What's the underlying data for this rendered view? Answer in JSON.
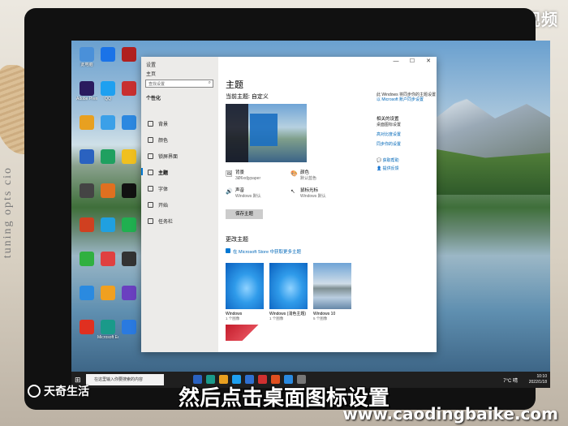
{
  "watermark_top": "天奇·视频",
  "book_text": "tuning opts cio",
  "desktop_icons": [
    {
      "label": "此电脑",
      "color": "#4a90d9"
    },
    {
      "label": "",
      "color": "#1a73e8"
    },
    {
      "label": "",
      "color": "#b02020"
    },
    {
      "label": "Adobe Premi...",
      "color": "#2a1a5e"
    },
    {
      "label": "QQ",
      "color": "#1ea0f0"
    },
    {
      "label": "",
      "color": "#c83030"
    },
    {
      "label": "",
      "color": "#e8a020"
    },
    {
      "label": "",
      "color": "#3ba0e8"
    },
    {
      "label": "",
      "color": "#2c88e0"
    },
    {
      "label": "",
      "color": "#2a62c0"
    },
    {
      "label": "",
      "color": "#20a060"
    },
    {
      "label": "",
      "color": "#f0c020"
    },
    {
      "label": "",
      "color": "#444"
    },
    {
      "label": "",
      "color": "#e07020"
    },
    {
      "label": "",
      "color": "#111"
    },
    {
      "label": "",
      "color": "#d04020"
    },
    {
      "label": "",
      "color": "#20a0e0"
    },
    {
      "label": "",
      "color": "#20b050"
    },
    {
      "label": "",
      "color": "#30b040"
    },
    {
      "label": "",
      "color": "#e04040"
    },
    {
      "label": "",
      "color": "#333"
    },
    {
      "label": "",
      "color": "#2a8ae0"
    },
    {
      "label": "",
      "color": "#f0a020"
    },
    {
      "label": "",
      "color": "#6a40c0"
    },
    {
      "label": "",
      "color": "#e03020"
    },
    {
      "label": "Microsoft Edge",
      "color": "#1a9a8a"
    },
    {
      "label": "",
      "color": "#2a7ae0"
    }
  ],
  "window": {
    "title": "设置",
    "home": "主页",
    "search_placeholder": "查找设置",
    "section": "个性化",
    "nav_items": [
      "背景",
      "颜色",
      "锁屏界面",
      "主题",
      "字体",
      "开始",
      "任务栏"
    ],
    "page_title": "主题",
    "current_theme": "当前主题: 自定义",
    "props": [
      {
        "icon": "🖼",
        "title": "背景",
        "sub": "3Ø6xdjypaper"
      },
      {
        "icon": "🎨",
        "title": "颜色",
        "sub": "默认蓝色"
      },
      {
        "icon": "🔊",
        "title": "声音",
        "sub": "Windows 默认"
      },
      {
        "icon": "↖",
        "title": "鼠标光标",
        "sub": "Windows 默认"
      }
    ],
    "save_theme": "保存主题",
    "change_theme": "更改主题",
    "store_link": "在 Microsoft Store 中获取更多主题",
    "themes": [
      {
        "name": "Windows",
        "sub": "1 个图像"
      },
      {
        "name": "Windows (浅色主题)",
        "sub": "1 个图像"
      },
      {
        "name": "Windows 10",
        "sub": "5 个图像"
      }
    ],
    "right": {
      "sync_text": "此 Windows 将同步你的主题设置",
      "sync_link": "以 Microsoft 账户同步设置",
      "related_head": "相关的设置",
      "desktop_icons_link": "桌面图标设置",
      "contrast_link": "高对比度设置",
      "sync_settings_link": "同步你的设置",
      "help": "获取帮助",
      "feedback": "提供反馈"
    }
  },
  "taskbar": {
    "search_placeholder": "在这里输入你要搜索的内容",
    "weather": "7°C 晴",
    "time": "10:10",
    "date": "2022/1/18"
  },
  "subtitle": "然后点击桌面图标设置",
  "brand_bottom_left": "天奇生活",
  "brand_bottom_right": "www.caodingbaike.com"
}
